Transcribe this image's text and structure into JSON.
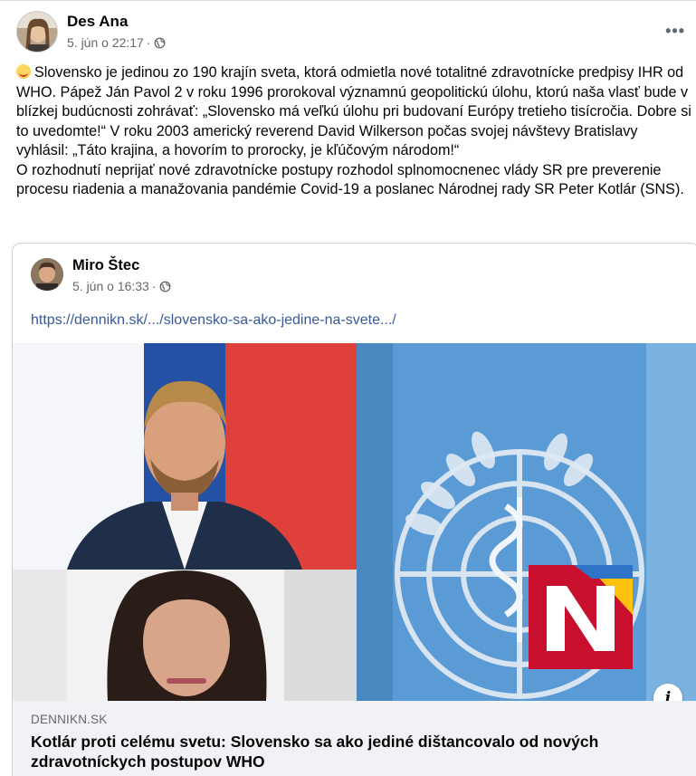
{
  "post": {
    "author": "Des Ana",
    "date": "5. jún o 22:17",
    "separator": "·",
    "privacy_icon": "globe-icon",
    "more_label": "•••",
    "text": "Slovensko je jedinou zo 190 krajín sveta, ktorá odmietla nové totalitné zdravotnícke predpisy IHR od WHO. Pápež Ján Pavol 2 v roku 1996 prorokoval významnú geopolitickú úlohu, ktorú naša vlasť bude v blízkej budúcnosti zohrávať: „Slovensko má veľkú úlohu pri budovaní Európy tretieho tisícročia. Dobre si to uvedomte!“ V roku 2003 americký reverend David Wilkerson počas svojej návštevy Bratislavy vyhlásil: „Táto krajina, a hovorím to prorocky, je kľúčovým národom!“\nO rozhodnutí neprijať nové zdravotnícke postupy rozhodol splnomocnenec vlády SR pre preverenie procesu riadenia a manažovania pandémie Covid-19 a poslanec Národnej rady SR Peter Kotlár (SNS).",
    "emoji_icon": "smiling-face-with-hearts-icon"
  },
  "shared": {
    "author": "Miro Štec",
    "date": "5. jún o 16:33",
    "separator": "·",
    "privacy_icon": "globe-icon",
    "link_text": "https://dennikn.sk/.../slovensko-sa-ako-jedine-na-svete.../",
    "preview": {
      "domain": "DENNIKN.SK",
      "headline": "Kotlár proti celému svetu: Slovensko sa ako jediné dištancovalo od nových zdravotníckych postupov WHO",
      "info_label": "i"
    }
  },
  "colors": {
    "link": "#385898",
    "secondary_text": "#65676b",
    "caption_bg": "#f0f2f5",
    "un_blue": "#5b9bd5",
    "n_logo_red": "#c8102e",
    "n_logo_yellow": "#ffc20e"
  }
}
